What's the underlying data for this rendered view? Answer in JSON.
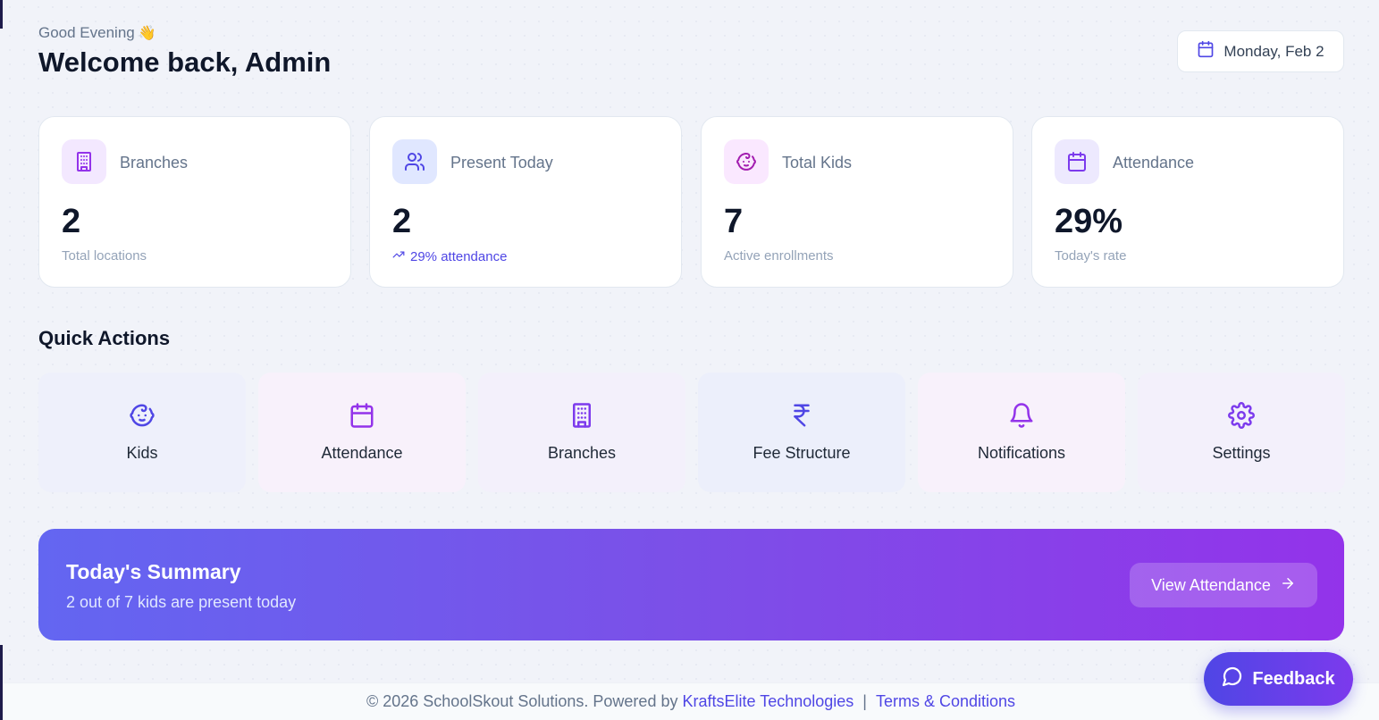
{
  "header": {
    "greeting": "Good Evening",
    "greeting_emoji": "👋",
    "welcome": "Welcome back, Admin",
    "date": "Monday, Feb 2"
  },
  "stats": [
    {
      "label": "Branches",
      "value": "2",
      "sub": "Total locations",
      "icon": "building-icon",
      "icon_bg": "#f3e8ff",
      "icon_color": "#9333ea"
    },
    {
      "label": "Present Today",
      "value": "2",
      "sub": "29% attendance",
      "icon": "users-icon",
      "icon_bg": "#e0e7ff",
      "icon_color": "#4f46e5"
    },
    {
      "label": "Total Kids",
      "value": "7",
      "sub": "Active enrollments",
      "icon": "baby-icon",
      "icon_bg": "#fae8ff",
      "icon_color": "#a21caf"
    },
    {
      "label": "Attendance",
      "value": "29%",
      "sub": "Today's rate",
      "icon": "calendar-icon",
      "icon_bg": "#ede9fe",
      "icon_color": "#7c3aed"
    }
  ],
  "quick_actions": {
    "title": "Quick Actions",
    "items": [
      {
        "label": "Kids",
        "icon": "baby-icon"
      },
      {
        "label": "Attendance",
        "icon": "calendar-icon"
      },
      {
        "label": "Branches",
        "icon": "building-icon"
      },
      {
        "label": "Fee Structure",
        "icon": "rupee-icon"
      },
      {
        "label": "Notifications",
        "icon": "bell-icon"
      },
      {
        "label": "Settings",
        "icon": "gear-icon"
      }
    ]
  },
  "summary": {
    "title": "Today's Summary",
    "subtitle": "2 out of 7 kids are present today",
    "button": "View Attendance"
  },
  "footer": {
    "copyright": "© 2026 SchoolSkout Solutions. Powered by",
    "company_link": "KraftsElite Technologies",
    "separator": "|",
    "terms_link": "Terms & Conditions"
  },
  "feedback": {
    "label": "Feedback"
  },
  "colors": {
    "accent": "#4f46e5",
    "purple": "#9333ea",
    "text_dark": "#0f172a"
  }
}
